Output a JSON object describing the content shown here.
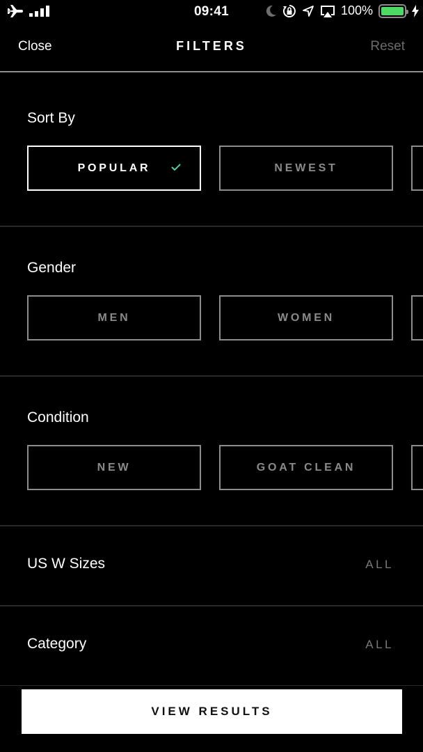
{
  "status_bar": {
    "time": "09:41",
    "battery_text": "100%",
    "battery_level": 1.0,
    "battery_color": "#4cd964",
    "icons": [
      "airplane-icon",
      "signal-icon",
      "moon-icon",
      "rotation-lock-icon",
      "location-icon",
      "airplay-icon",
      "battery-icon",
      "charging-icon"
    ]
  },
  "nav": {
    "close_label": "Close",
    "title": "FILTERS",
    "reset_label": "Reset"
  },
  "sections": [
    {
      "label": "Sort By",
      "options": [
        {
          "label": "POPULAR",
          "selected": true
        },
        {
          "label": "NEWEST",
          "selected": false
        },
        {
          "label": "",
          "selected": false
        }
      ]
    },
    {
      "label": "Gender",
      "options": [
        {
          "label": "MEN",
          "selected": false
        },
        {
          "label": "WOMEN",
          "selected": false
        },
        {
          "label": "",
          "selected": false
        }
      ]
    },
    {
      "label": "Condition",
      "options": [
        {
          "label": "NEW",
          "selected": false
        },
        {
          "label": "GOAT CLEAN",
          "selected": false
        },
        {
          "label": "",
          "selected": false
        }
      ]
    }
  ],
  "rows": [
    {
      "label": "US W Sizes",
      "value": "ALL"
    },
    {
      "label": "Category",
      "value": "ALL"
    }
  ],
  "accent_color": "#4fd1a5",
  "footer": {
    "view_results_label": "VIEW RESULTS"
  }
}
